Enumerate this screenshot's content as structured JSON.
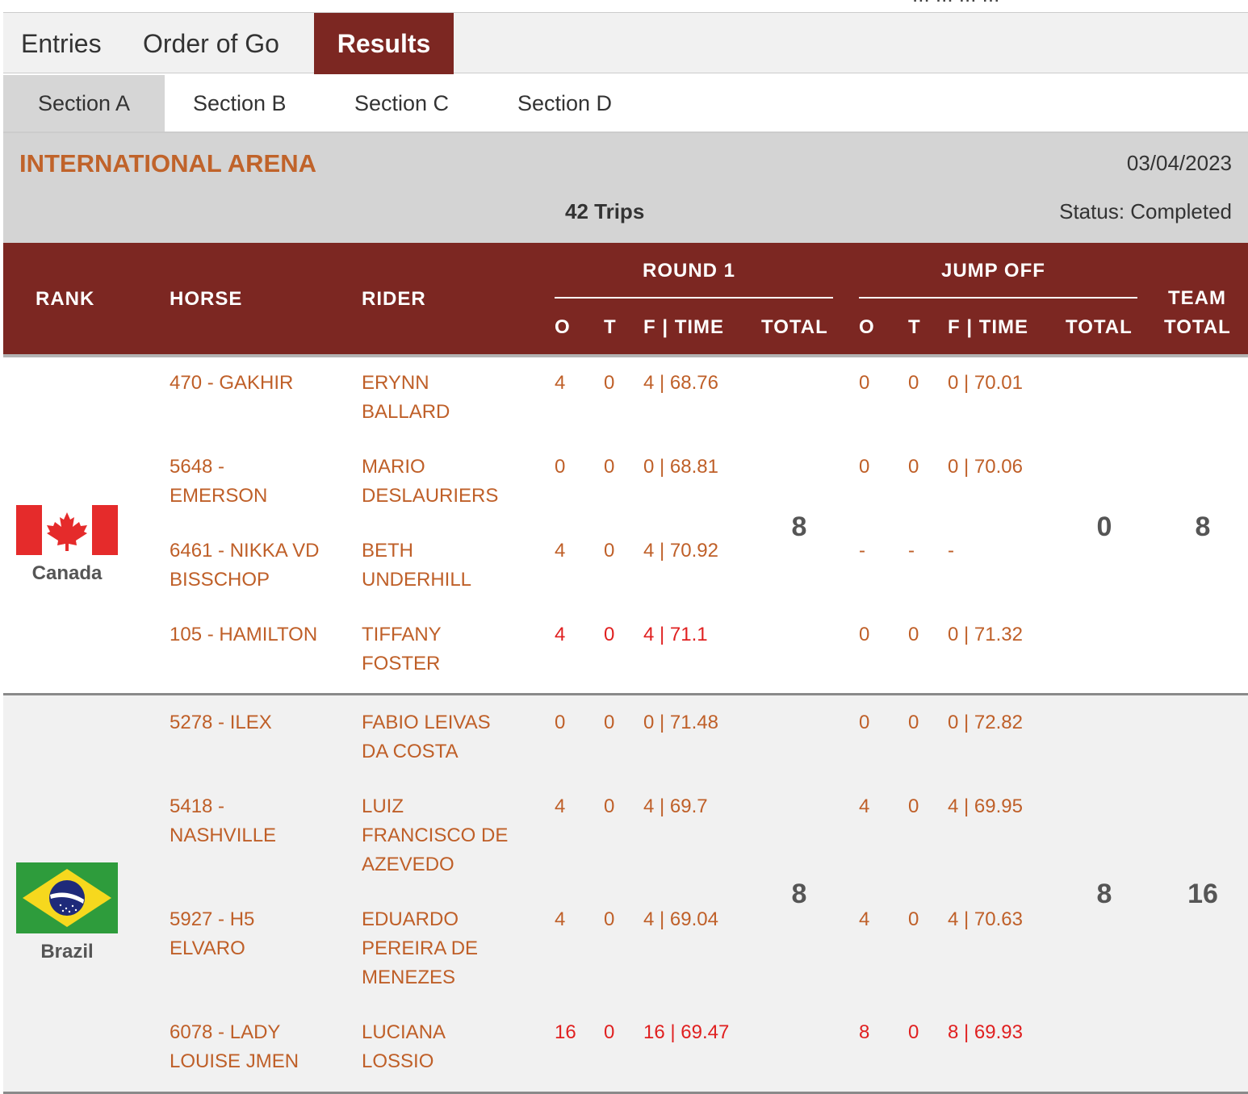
{
  "top_clipped_text": "... ... ... ...",
  "tabs": [
    {
      "label": "Entries",
      "active": false
    },
    {
      "label": "Order of Go",
      "active": false
    },
    {
      "label": "Results",
      "active": true
    }
  ],
  "sections": [
    {
      "label": "Section A",
      "active": true
    },
    {
      "label": "Section B",
      "active": false
    },
    {
      "label": "Section C",
      "active": false
    },
    {
      "label": "Section D",
      "active": false
    }
  ],
  "arena": {
    "name": "INTERNATIONAL ARENA",
    "date": "03/04/2023",
    "trips": "42 Trips",
    "status": "Status: Completed"
  },
  "table_header": {
    "rank": "RANK",
    "horse": "HORSE",
    "rider": "RIDER",
    "round1": "ROUND 1",
    "jumpoff": "JUMP OFF",
    "o": "O",
    "t": "T",
    "ftime": "F | TIME",
    "total": "TOTAL",
    "team_total_line1": "TEAM",
    "team_total_line2": "TOTAL"
  },
  "teams": [
    {
      "country": "Canada",
      "flag": "canada-flag",
      "round1_total": "8",
      "jumpoff_total": "0",
      "team_total": "8",
      "rows": [
        {
          "horse": [
            "470 - GAKHIR"
          ],
          "rider": [
            "ERYNN",
            "BALLARD"
          ],
          "r1": [
            "4",
            "0",
            "4 | 68.76"
          ],
          "jo": [
            "0",
            "0",
            "0 | 70.01"
          ],
          "highlight": false
        },
        {
          "horse": [
            "5648 -",
            "EMERSON"
          ],
          "rider": [
            "MARIO",
            "DESLAURIERS"
          ],
          "r1": [
            "0",
            "0",
            "0 | 68.81"
          ],
          "jo": [
            "0",
            "0",
            "0 | 70.06"
          ],
          "highlight": false
        },
        {
          "horse": [
            "6461 - NIKKA VD",
            "BISSCHOP"
          ],
          "rider": [
            "BETH",
            "UNDERHILL"
          ],
          "r1": [
            "4",
            "0",
            "4 | 70.92"
          ],
          "jo": [
            "-",
            "-",
            "-"
          ],
          "highlight": false
        },
        {
          "horse": [
            "105 - HAMILTON"
          ],
          "rider": [
            "TIFFANY",
            "FOSTER"
          ],
          "r1": [
            "4",
            "0",
            "4 | 71.1"
          ],
          "jo": [
            "0",
            "0",
            "0 | 71.32"
          ],
          "highlight": true,
          "jo_highlight": false
        }
      ]
    },
    {
      "country": "Brazil",
      "flag": "brazil-flag",
      "round1_total": "8",
      "jumpoff_total": "8",
      "team_total": "16",
      "rows": [
        {
          "horse": [
            "5278 - ILEX"
          ],
          "rider": [
            "FABIO LEIVAS",
            "DA COSTA"
          ],
          "r1": [
            "0",
            "0",
            "0 | 71.48"
          ],
          "jo": [
            "0",
            "0",
            "0 | 72.82"
          ],
          "highlight": false
        },
        {
          "horse": [
            "5418 -",
            "NASHVILLE"
          ],
          "rider": [
            "LUIZ",
            "FRANCISCO DE",
            "AZEVEDO"
          ],
          "r1": [
            "4",
            "0",
            "4 | 69.7"
          ],
          "jo": [
            "4",
            "0",
            "4 | 69.95"
          ],
          "highlight": false
        },
        {
          "horse": [
            "5927 - H5",
            "ELVARO"
          ],
          "rider": [
            "EDUARDO",
            "PEREIRA DE",
            "MENEZES"
          ],
          "r1": [
            "4",
            "0",
            "4 | 69.04"
          ],
          "jo": [
            "4",
            "0",
            "4 | 70.63"
          ],
          "highlight": false
        },
        {
          "horse": [
            "6078 - LADY",
            "LOUISE JMEN"
          ],
          "rider": [
            "LUCIANA",
            "LOSSIO"
          ],
          "r1": [
            "16",
            "0",
            "16 | 69.47"
          ],
          "jo": [
            "8",
            "0",
            "8 | 69.93"
          ],
          "highlight": true,
          "jo_highlight": true
        }
      ]
    }
  ],
  "colors": {
    "header_bg": "#7c2722",
    "link_orange": "#bf5f28",
    "highlight_red": "#e02020",
    "arena_bar": "#d4d4d4"
  }
}
